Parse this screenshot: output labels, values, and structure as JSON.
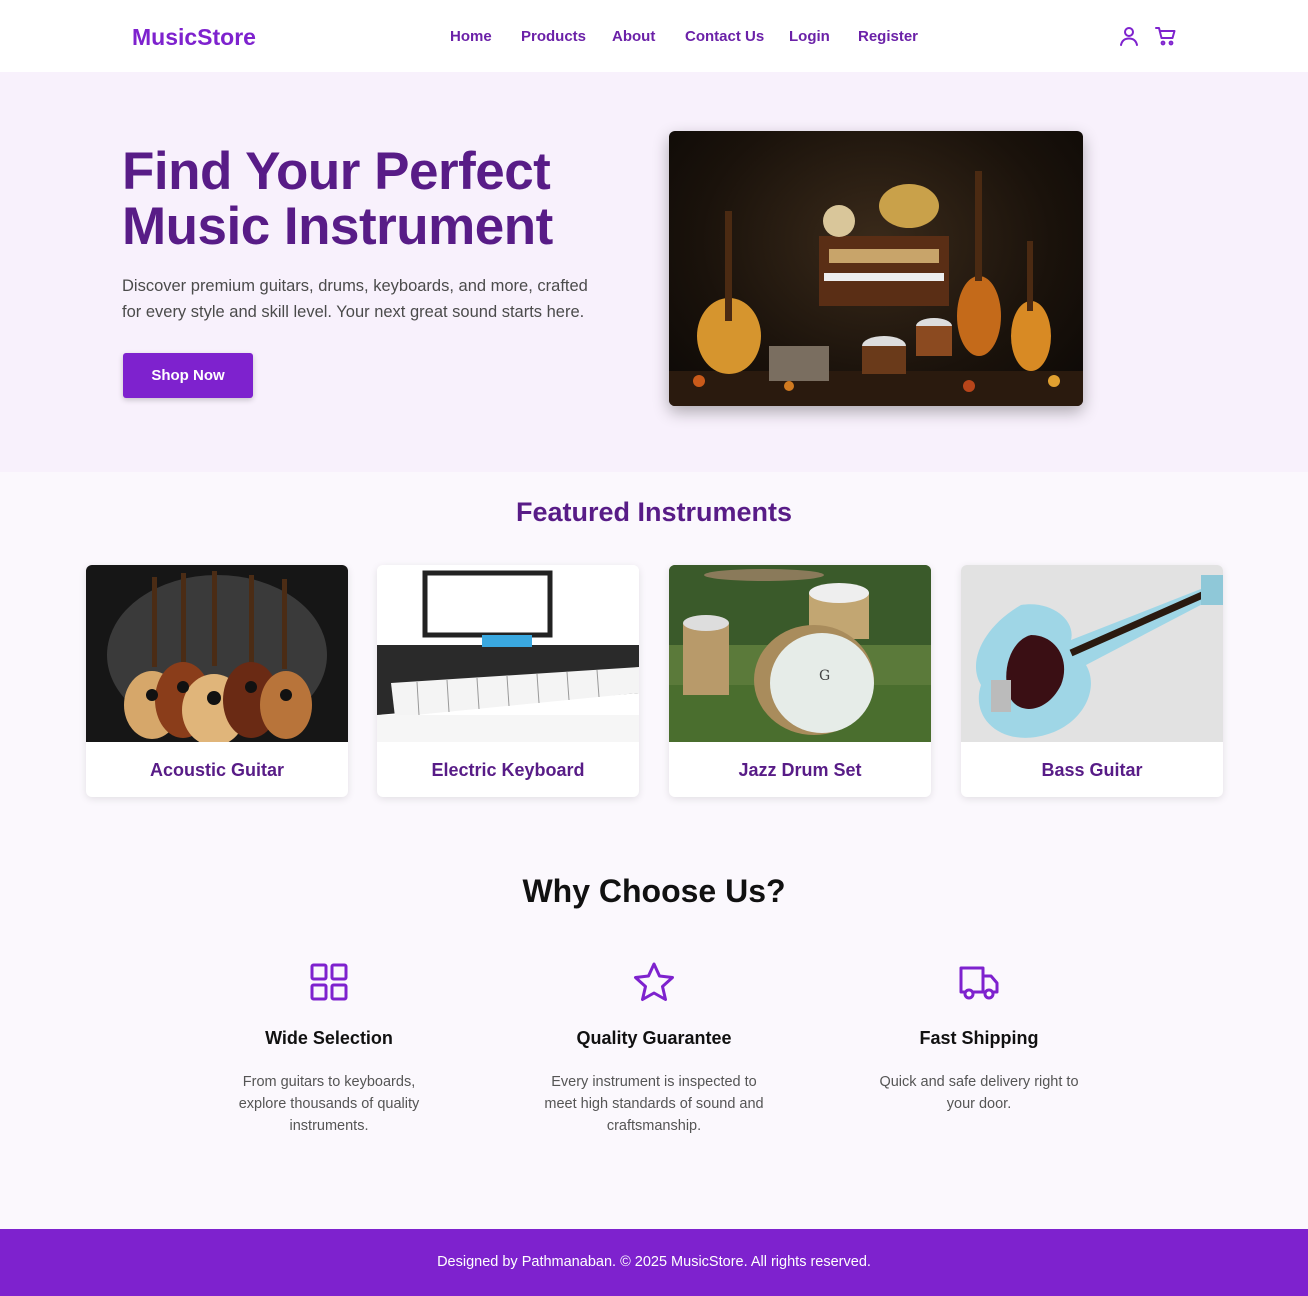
{
  "brand": {
    "name": "MusicStore",
    "accent": "#7e22ce",
    "dark_accent": "#581c87"
  },
  "nav": {
    "items": [
      {
        "label": "Home"
      },
      {
        "label": "Products"
      },
      {
        "label": "About"
      },
      {
        "label": "Contact Us"
      },
      {
        "label": "Login"
      },
      {
        "label": "Register"
      }
    ],
    "icons": [
      "user-icon",
      "cart-icon"
    ]
  },
  "hero": {
    "title_line1": "Find Your Perfect",
    "title_line2": "Music Instrument",
    "subtitle": "Discover premium guitars, drums, keyboards, and more, crafted for every style and skill level. Your next great sound starts here.",
    "cta": "Shop Now"
  },
  "featured": {
    "title": "Featured Instruments",
    "items": [
      {
        "label": "Acoustic Guitar"
      },
      {
        "label": "Electric Keyboard"
      },
      {
        "label": "Jazz Drum Set"
      },
      {
        "label": "Bass Guitar"
      }
    ]
  },
  "why": {
    "title": "Why Choose Us?",
    "features": [
      {
        "icon": "grid-icon",
        "title": "Wide Selection",
        "text": "From guitars to keyboards, explore thousands of quality instruments."
      },
      {
        "icon": "star-icon",
        "title": "Quality Guarantee",
        "text": "Every instrument is inspected to meet high standards of sound and craftsmanship."
      },
      {
        "icon": "truck-icon",
        "title": "Fast Shipping",
        "text": "Quick and safe delivery right to your door."
      }
    ]
  },
  "footer": {
    "text": "Designed by Pathmanaban. © 2025 MusicStore. All rights reserved."
  }
}
